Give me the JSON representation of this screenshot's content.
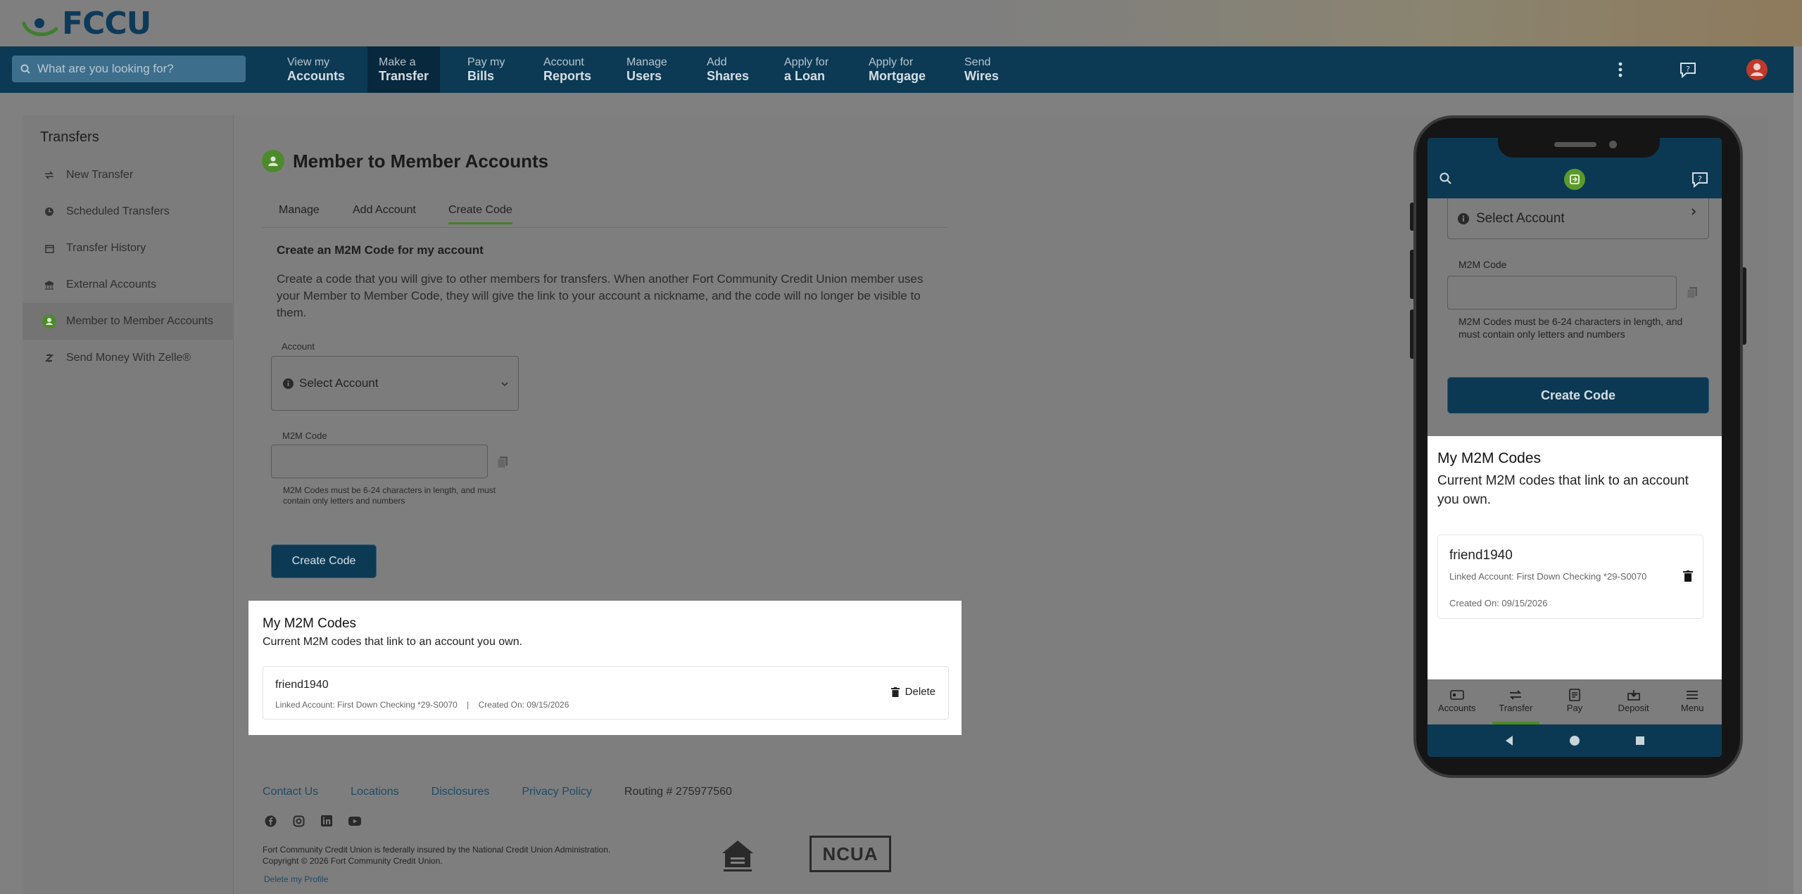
{
  "brand": {
    "name": "FCCU",
    "primary": "#0c3a55",
    "accent": "#4d8a2c"
  },
  "search": {
    "placeholder": "What are you looking for?"
  },
  "nav": [
    {
      "l1": "View my",
      "l2": "Accounts"
    },
    {
      "l1": "Make a",
      "l2": "Transfer",
      "active": true
    },
    {
      "l1": "Pay my",
      "l2": "Bills"
    },
    {
      "l1": "Account",
      "l2": "Reports"
    },
    {
      "l1": "Manage",
      "l2": "Users"
    },
    {
      "l1": "Add",
      "l2": "Shares"
    },
    {
      "l1": "Apply for",
      "l2": "a Loan"
    },
    {
      "l1": "Apply for",
      "l2": "Mortgage"
    },
    {
      "l1": "Send",
      "l2": "Wires"
    }
  ],
  "nav_right_icons": [
    "more-vertical-icon",
    "help-chat-icon",
    "user-avatar-icon"
  ],
  "sidebar": {
    "title": "Transfers",
    "items": [
      {
        "label": "New Transfer",
        "icon": "arrows-swap-icon"
      },
      {
        "label": "Scheduled Transfers",
        "icon": "clock-icon"
      },
      {
        "label": "Transfer History",
        "icon": "calendar-icon"
      },
      {
        "label": "External Accounts",
        "icon": "bank-icon"
      },
      {
        "label": "Member to Member Accounts",
        "icon": "member-icon",
        "active": true
      },
      {
        "label": "Send Money With Zelle®",
        "icon": "zelle-icon"
      }
    ]
  },
  "page": {
    "title": "Member to Member Accounts",
    "tabs": [
      {
        "label": "Manage"
      },
      {
        "label": "Add Account"
      },
      {
        "label": "Create Code",
        "active": true
      }
    ],
    "section_heading": "Create an M2M Code for my account",
    "description": "Create a code that you will give to other members for transfers. When another Fort Community Credit Union member uses your Member to Member Code, they will give the link to your account a nickname, and the code will no longer be visible to them.",
    "account_label": "Account",
    "account_select": "Select Account",
    "m2m_label": "M2M Code",
    "m2m_value": "",
    "m2m_hint": "M2M Codes must be 6-24 characters in length, and must contain only letters and numbers",
    "create_button": "Create Code"
  },
  "codes": {
    "title": "My M2M Codes",
    "subtitle": "Current M2M codes that link to an account you own.",
    "items": [
      {
        "name": "friend1940",
        "linked": "Linked Account: First Down Checking *29-S0070",
        "separator": "|",
        "created": "Created On: 09/15/2026",
        "delete_label": "Delete"
      }
    ]
  },
  "footer": {
    "links": [
      "Contact Us",
      "Locations",
      "Disclosures",
      "Privacy Policy"
    ],
    "routing": "Routing # 275977560",
    "social": [
      "facebook-icon",
      "instagram-icon",
      "linkedin-icon",
      "youtube-icon"
    ],
    "legal1": "Fort Community Credit Union is federally insured by the National Credit Union Administration.",
    "legal2": "Copyright © 2026 Fort Community Credit Union.",
    "delete_profile": "Delete my Profile",
    "ncua": "NCUA"
  },
  "phone": {
    "select": "Select Account",
    "m2m_label": "M2M Code",
    "hint": "M2M Codes must be 6-24 characters in length, and must contain only letters and numbers",
    "create_button": "Create Code",
    "codes_title": "My M2M Codes",
    "codes_subtitle": "Current M2M codes that link to an account you own.",
    "code_name": "friend1940",
    "code_linked": "Linked Account: First Down Checking *29-S0070",
    "code_created": "Created On: 09/15/2026",
    "tabbar": [
      {
        "label": "Accounts",
        "icon": "accounts-icon"
      },
      {
        "label": "Transfer",
        "icon": "transfer-icon",
        "active": true
      },
      {
        "label": "Pay",
        "icon": "pay-icon"
      },
      {
        "label": "Deposit",
        "icon": "deposit-icon"
      },
      {
        "label": "Menu",
        "icon": "menu-icon"
      }
    ]
  }
}
